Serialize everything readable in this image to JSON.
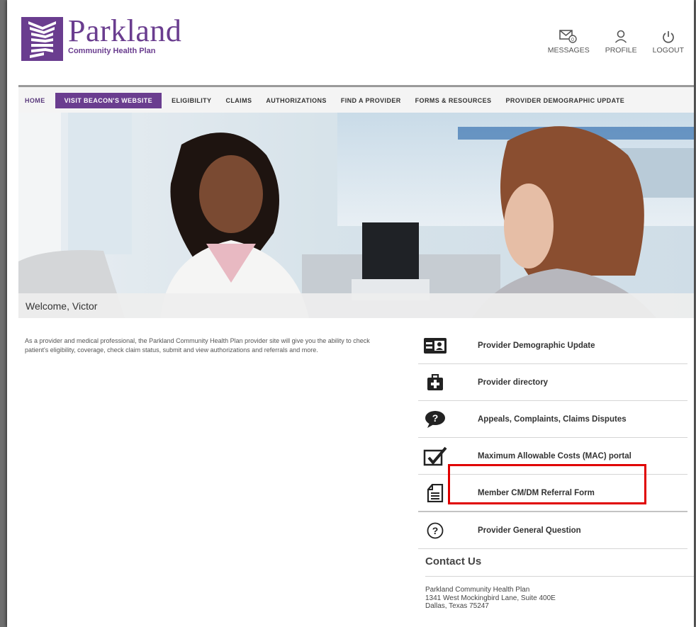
{
  "header": {
    "brand_name": "Parkland",
    "brand_subtitle": "Community Health Plan",
    "actions": [
      {
        "label": "MESSAGES",
        "icon": "envelope-icon",
        "badge": "0"
      },
      {
        "label": "PROFILE",
        "icon": "user-icon"
      },
      {
        "label": "LOGOUT",
        "icon": "power-icon"
      }
    ]
  },
  "nav": {
    "items": [
      {
        "label": "HOME"
      },
      {
        "label": "VISIT BEACON'S WEBSITE"
      },
      {
        "label": "ELIGIBILITY"
      },
      {
        "label": "CLAIMS"
      },
      {
        "label": "AUTHORIZATIONS"
      },
      {
        "label": "FIND A PROVIDER"
      },
      {
        "label": "FORMS & RESOURCES"
      },
      {
        "label": "PROVIDER DEMOGRAPHIC UPDATE"
      }
    ],
    "active": "HOME"
  },
  "welcome": "Welcome, Victor",
  "intro": "As a provider and medical professional, the Parkland Community Health Plan provider site will give you the ability to check patient's eligibility, coverage, check claim status, submit and view authorizations and referrals and more.",
  "links": [
    {
      "label": "Provider Demographic Update",
      "icon": "id-card-icon"
    },
    {
      "label": "Provider directory",
      "icon": "medical-kit-icon"
    },
    {
      "label": "Appeals, Complaints, Claims Disputes",
      "icon": "question-bubble-icon"
    },
    {
      "label": "Maximum Allowable Costs (MAC) portal",
      "icon": "checkbox-icon"
    },
    {
      "label": "Member CM/DM Referral Form",
      "icon": "document-icon"
    },
    {
      "label": "Provider General Question",
      "icon": "question-circle-icon"
    }
  ],
  "contact": {
    "title": "Contact Us",
    "lines": [
      "Parkland Community Health Plan",
      "1341 West Mockingbird Lane, Suite 400E",
      "Dallas, Texas  75247"
    ]
  },
  "colors": {
    "brand": "#6a3d8f",
    "highlight": "#e00000"
  }
}
